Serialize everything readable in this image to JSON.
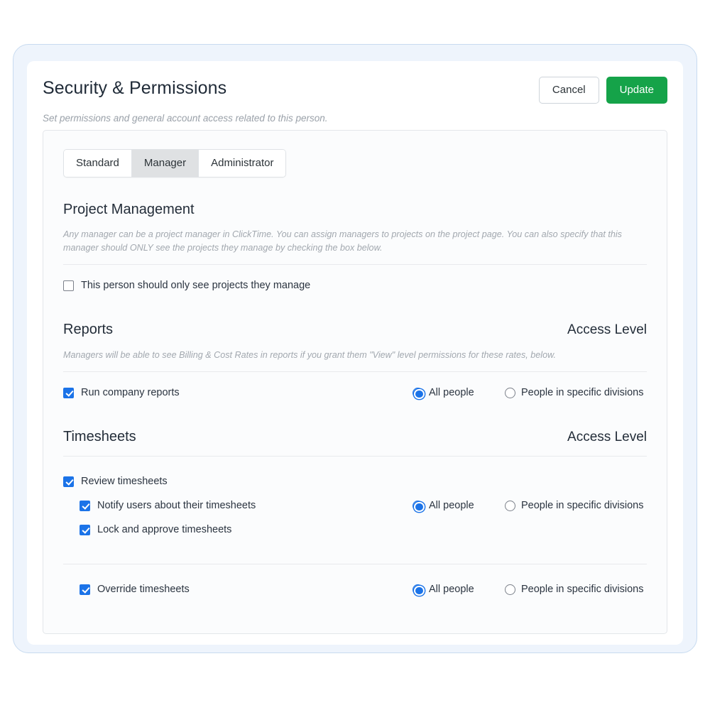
{
  "header": {
    "title": "Security & Permissions",
    "subtitle": "Set permissions and general account access related to this person.",
    "cancel_label": "Cancel",
    "update_label": "Update",
    "update_color": "#15a349"
  },
  "tabs": [
    {
      "label": "Standard",
      "active": false
    },
    {
      "label": "Manager",
      "active": true
    },
    {
      "label": "Administrator",
      "active": false
    }
  ],
  "accent_color": "#1b73e8",
  "access_level_label": "Access Level",
  "sections": {
    "project_management": {
      "title": "Project Management",
      "description": "Any manager can be a project manager in ClickTime. You can assign managers to projects on the project page. You can also specify that this manager should ONLY see the projects they manage by checking the box below.",
      "option": {
        "label": "This person should only see projects they manage",
        "checked": false
      }
    },
    "reports": {
      "title": "Reports",
      "access_label": "Access Level",
      "description": "Managers will be able to see Billing & Cost Rates in reports if you grant them \"View\" level permissions for these rates, below.",
      "option": {
        "label": "Run company reports",
        "checked": true
      },
      "radios": [
        {
          "label": "All people",
          "selected": true
        },
        {
          "label": "People in specific divisions",
          "selected": false
        }
      ]
    },
    "timesheets": {
      "title": "Timesheets",
      "access_label": "Access Level",
      "group_one": {
        "parent": {
          "label": "Review timesheets",
          "checked": true
        },
        "children": [
          {
            "label": "Notify users about their timesheets",
            "checked": true
          },
          {
            "label": "Lock and approve timesheets",
            "checked": true
          }
        ],
        "radios": [
          {
            "label": "All people",
            "selected": true
          },
          {
            "label": "People in specific divisions",
            "selected": false
          }
        ]
      },
      "group_two": {
        "option": {
          "label": "Override timesheets",
          "checked": true
        },
        "radios": [
          {
            "label": "All people",
            "selected": true
          },
          {
            "label": "People in specific divisions",
            "selected": false
          }
        ]
      }
    }
  }
}
